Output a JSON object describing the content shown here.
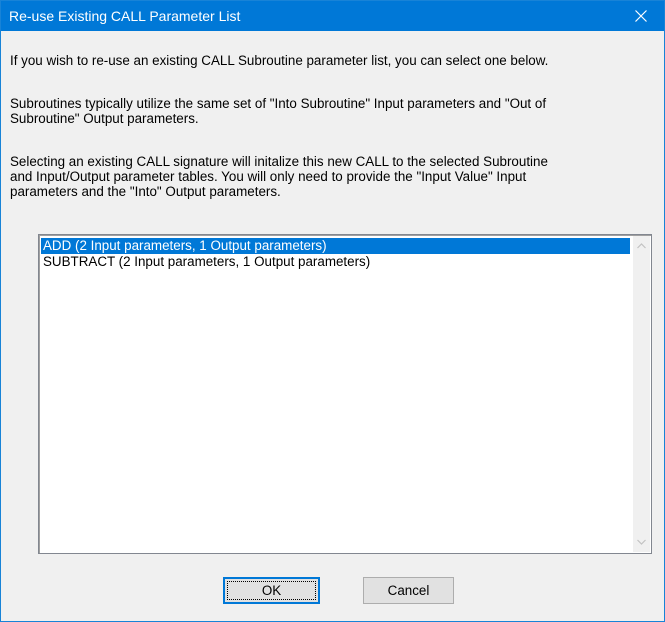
{
  "window": {
    "title": "Re-use Existing CALL Parameter List"
  },
  "message": {
    "line1": "If you wish to re-use an existing CALL Subroutine parameter list, you can select one below.",
    "para2": "Subroutines typically utilize the same set of \"Into Subroutine\" Input parameters and \"Out of\nSubroutine\" Output parameters.",
    "para3": "Selecting an existing CALL signature will initalize this new CALL to the selected Subroutine\nand Input/Output parameter tables.  You will only need to provide the \"Input Value\" Input\nparameters and the \"Into\" Output parameters."
  },
  "list": {
    "items": [
      {
        "label": "ADD (2 Input parameters, 1 Output parameters)",
        "selected": true
      },
      {
        "label": "SUBTRACT (2 Input parameters, 1 Output parameters)",
        "selected": false
      }
    ]
  },
  "buttons": {
    "ok": "OK",
    "cancel": "Cancel"
  },
  "colors": {
    "titlebar": "#0078d7",
    "selection": "#0078d7",
    "dialog_bg": "#f0f0f0"
  },
  "icons": {
    "close": "close-icon",
    "scroll_up": "chevron-up-icon",
    "scroll_down": "chevron-down-icon"
  }
}
